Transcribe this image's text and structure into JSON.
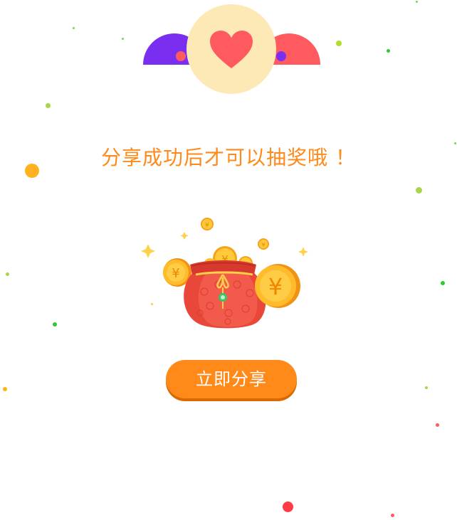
{
  "title": "分享成功后才可以抽奖哦 ！",
  "share_button_label": "立即分享",
  "coin_symbol": "¥",
  "colors": {
    "accent_orange": "#ff8a1a",
    "wing_purple": "#7a2ff0",
    "wing_red": "#ff5a60",
    "heart_circle": "#fde9b5",
    "heart": "#ff5a60",
    "purse_red": "#e8473a",
    "coin_gold": "#ffb21e"
  },
  "icons": {
    "heart": "heart-icon",
    "purse": "money-bag-icon",
    "coin": "yuan-coin-icon",
    "sparkle": "sparkle-icon"
  }
}
